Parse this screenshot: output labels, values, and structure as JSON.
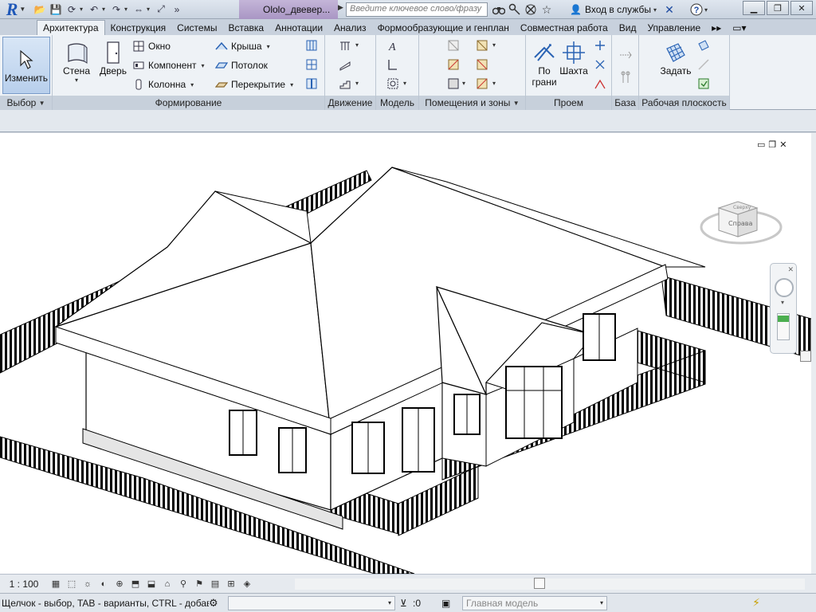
{
  "titlebar": {
    "app_logo": "R",
    "doc_title": "Ololo_двевер...",
    "search_placeholder": "Введите ключевое слово/фразу",
    "login_label": "Вход в службы",
    "icons": [
      "binoculars-icon",
      "key-icon",
      "star-icon",
      "help-icon"
    ]
  },
  "tabs": [
    {
      "label": "Архитектура",
      "active": true
    },
    {
      "label": "Конструкция"
    },
    {
      "label": "Системы"
    },
    {
      "label": "Вставка"
    },
    {
      "label": "Аннотации"
    },
    {
      "label": "Анализ"
    },
    {
      "label": "Формообразующие и генплан"
    },
    {
      "label": "Совместная работа"
    },
    {
      "label": "Вид"
    },
    {
      "label": "Управление"
    }
  ],
  "ribbon": {
    "select": {
      "modify_label": "Изменить",
      "panel_title": "Выбор"
    },
    "build": {
      "wall_label": "Стена",
      "door_label": "Дверь",
      "window_label": "Окно",
      "component_label": "Компонент",
      "column_label": "Колонна",
      "roof_label": "Крыша",
      "ceiling_label": "Потолок",
      "floor_label": "Перекрытие",
      "panel_title": "Формирование"
    },
    "circulation": {
      "panel_title": "Движение"
    },
    "model": {
      "panel_title": "Модель"
    },
    "room": {
      "panel_title": "Помещения и зоны"
    },
    "opening": {
      "by_face_label": "По\nграни",
      "by_face_line1": "По",
      "by_face_line2": "грани",
      "shaft_label": "Шахта",
      "panel_title": "Проем"
    },
    "datum": {
      "panel_title": "База"
    },
    "workplane": {
      "set_label": "Задать",
      "panel_title": "Рабочая плоскость"
    }
  },
  "viewbar": {
    "scale": "1 : 100"
  },
  "statusbar": {
    "text": "Щелчок - выбор, TAB - варианты, CTRL - добав",
    "selection_count": ":0",
    "model_label": "Главная модель"
  },
  "viewcube": {
    "face_label": "Справа",
    "top_label": "Сверху"
  },
  "colors": {
    "ribbon_bg": "#eef2f6",
    "title_accent": "#a996c4",
    "logo_blue": "#1f58b8"
  }
}
